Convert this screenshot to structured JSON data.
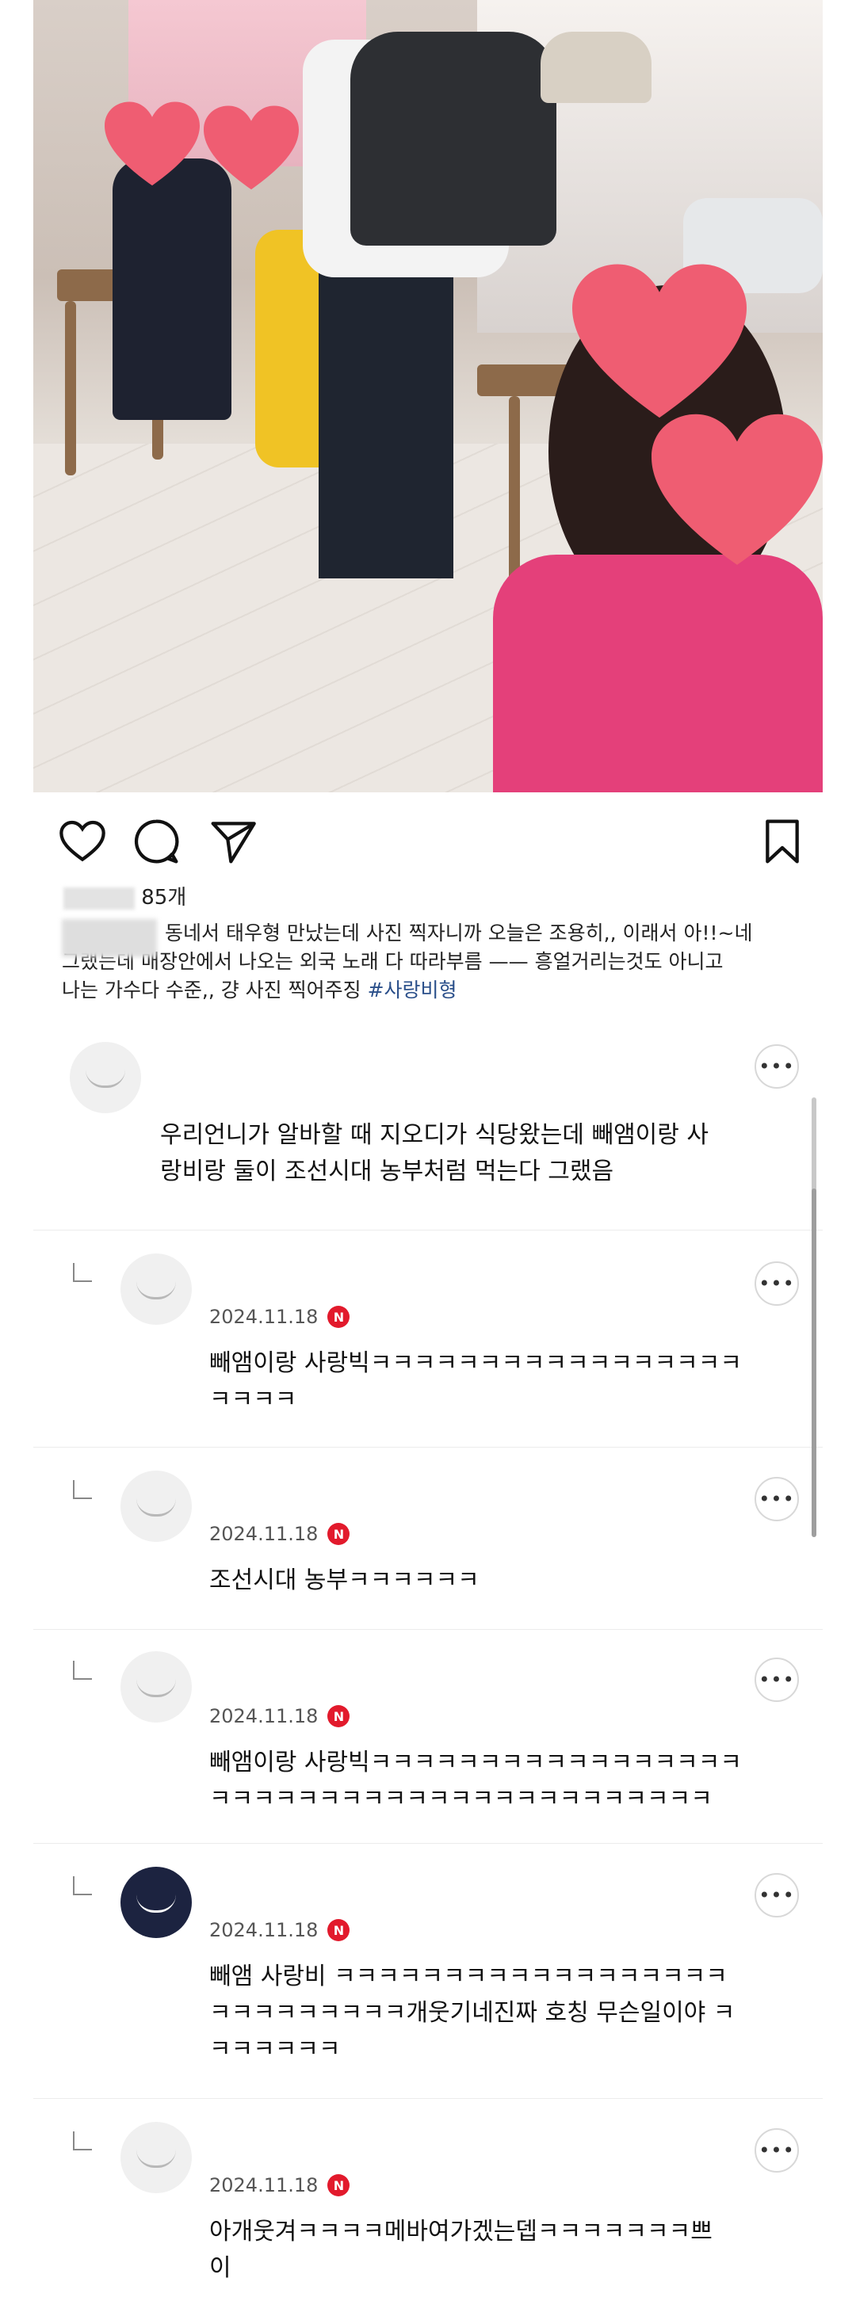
{
  "post": {
    "likes_suffix": "85개",
    "caption_lines": [
      "동네서 태우형 만났는데 사진 찍자니까 오늘은 조용히,, 이래서 아!!~네",
      "그랬는데 매장안에서 나오는 외국 노래 다 따라부름 —— 흥얼거리는것도 아니고",
      "나는 가수다 수준,, 걍 사진 찍어주징"
    ],
    "hashtag": "#사랑비형"
  },
  "comments": [
    {
      "type": "top",
      "date": "",
      "text_lines": [
        "우리언니가 알바할 때 지오디가 식당왔는데 빼앰이랑 사",
        "랑비랑 둘이 조선시대 농부처럼 먹는다 그랬음"
      ]
    },
    {
      "type": "reply",
      "date": "2024.11.18",
      "text_lines": [
        "빼앰이랑 사랑빅ㅋㅋㅋㅋㅋㅋㅋㅋㅋㅋㅋㅋㅋㅋㅋㅋㅋ",
        "ㅋㅋㅋㅋ"
      ]
    },
    {
      "type": "reply",
      "date": "2024.11.18",
      "text_lines": [
        "조선시대 농부ㅋㅋㅋㅋㅋㅋ"
      ]
    },
    {
      "type": "reply",
      "date": "2024.11.18",
      "text_lines": [
        "빼앰이랑 사랑빅ㅋㅋㅋㅋㅋㅋㅋㅋㅋㅋㅋㅋㅋㅋㅋㅋㅋ",
        "ㅋㅋㅋㅋㅋㅋㅋㅋㅋㅋㅋㅋㅋㅋㅋㅋㅋㅋㅋㅋㅋㅋㅋ"
      ]
    },
    {
      "type": "reply",
      "date": "2024.11.18",
      "text_lines": [
        "빼앰 사랑비 ㅋㅋㅋㅋㅋㅋㅋㅋㅋㅋㅋㅋㅋㅋㅋㅋㅋㅋ",
        "ㅋㅋㅋㅋㅋㅋㅋㅋㅋ개웃기네진짜 호칭 무슨일이야 ㅋ",
        "ㅋㅋㅋㅋㅋㅋ"
      ]
    },
    {
      "type": "reply",
      "date": "2024.11.18",
      "text_lines": [
        "아개웃겨ㅋㅋㅋㅋ메바여가겠는뎁ㅋㅋㅋㅋㅋㅋㅋ쁘",
        "이"
      ]
    }
  ],
  "badge": "N",
  "icons": {
    "like": "heart-outline-icon",
    "comment": "comment-bubble-icon",
    "share": "send-icon",
    "save": "bookmark-icon",
    "more": "ellipsis-icon"
  },
  "colors": {
    "hashtag": "#2a4f8a",
    "badge": "#e21a2c",
    "heart_sticker": "#ef5d72"
  }
}
